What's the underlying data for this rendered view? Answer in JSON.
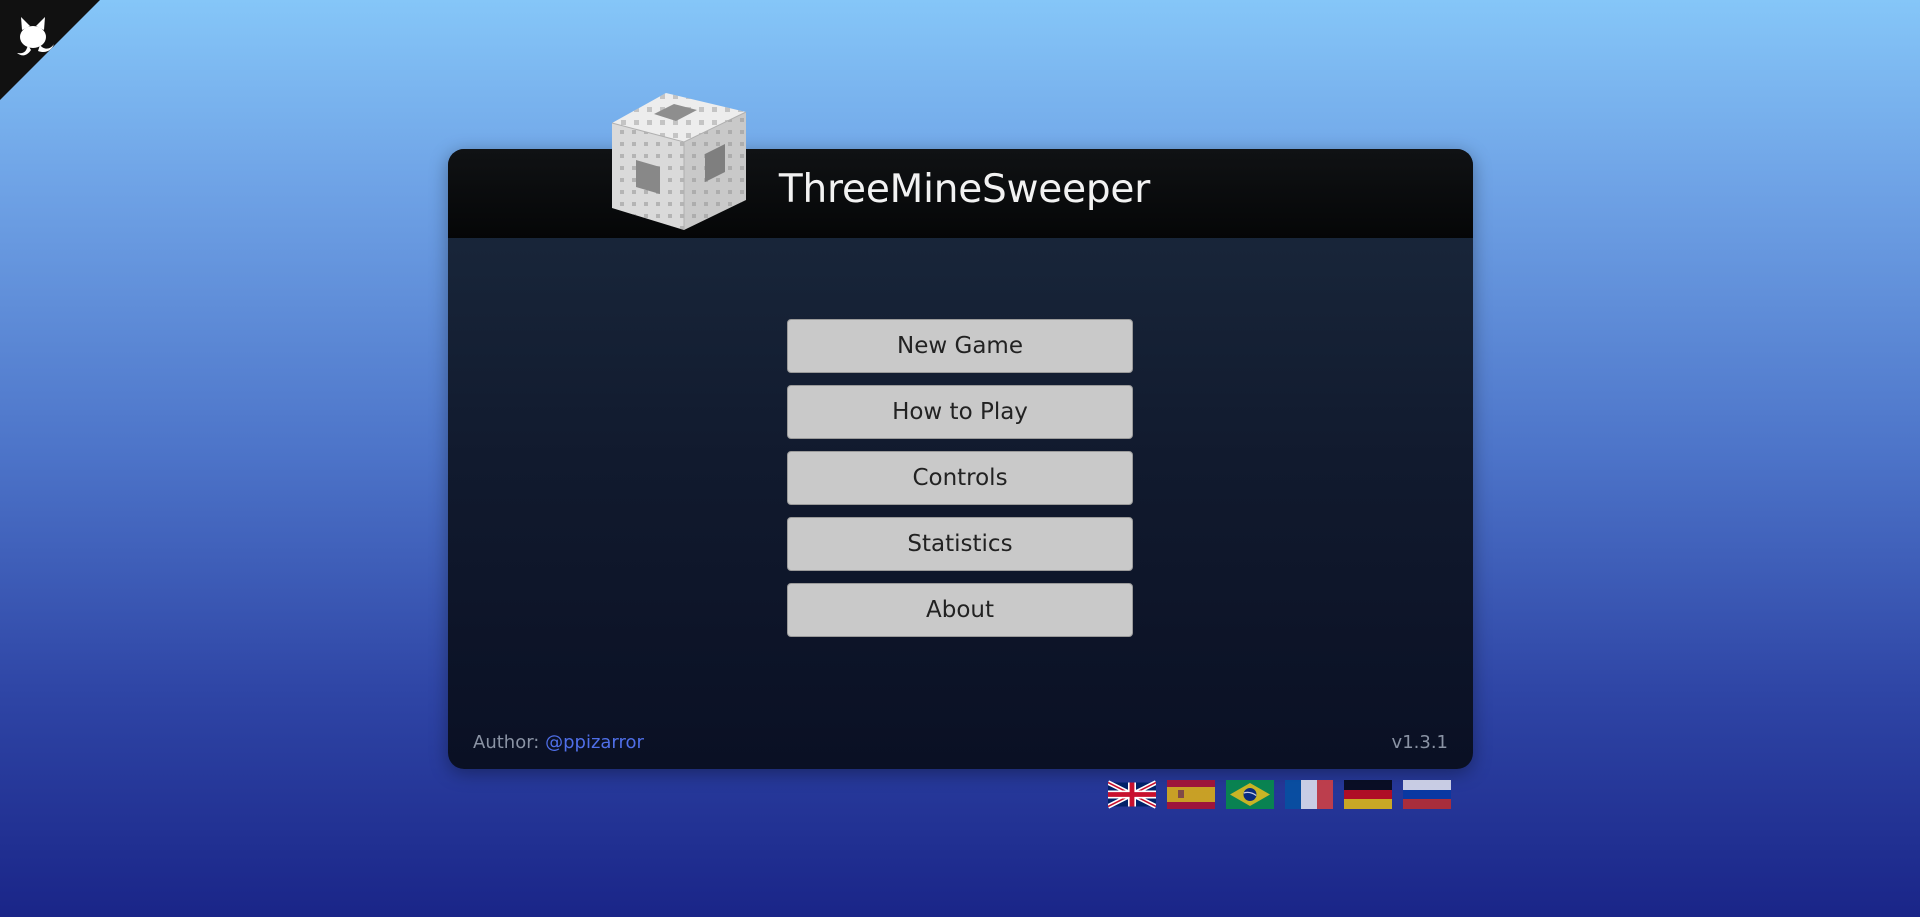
{
  "app": {
    "title": "ThreeMineSweeper"
  },
  "corner": {
    "icon": "github-octocat-icon",
    "background_color": "#111111"
  },
  "menu": {
    "items": [
      {
        "label": "New Game"
      },
      {
        "label": "How to Play"
      },
      {
        "label": "Controls"
      },
      {
        "label": "Statistics"
      },
      {
        "label": "About"
      }
    ]
  },
  "footer": {
    "author_label": "Author:",
    "author_handle": "@ppizarror",
    "version": "v1.3.1"
  },
  "languages": [
    {
      "name": "uk-flag-icon"
    },
    {
      "name": "spain-flag-icon"
    },
    {
      "name": "brazil-flag-icon"
    },
    {
      "name": "france-flag-icon"
    },
    {
      "name": "germany-flag-icon"
    },
    {
      "name": "russia-flag-icon"
    }
  ],
  "colors": {
    "button_bg": "#c9c9c9",
    "link": "#4f6fe8",
    "header_bg": "#050607"
  }
}
